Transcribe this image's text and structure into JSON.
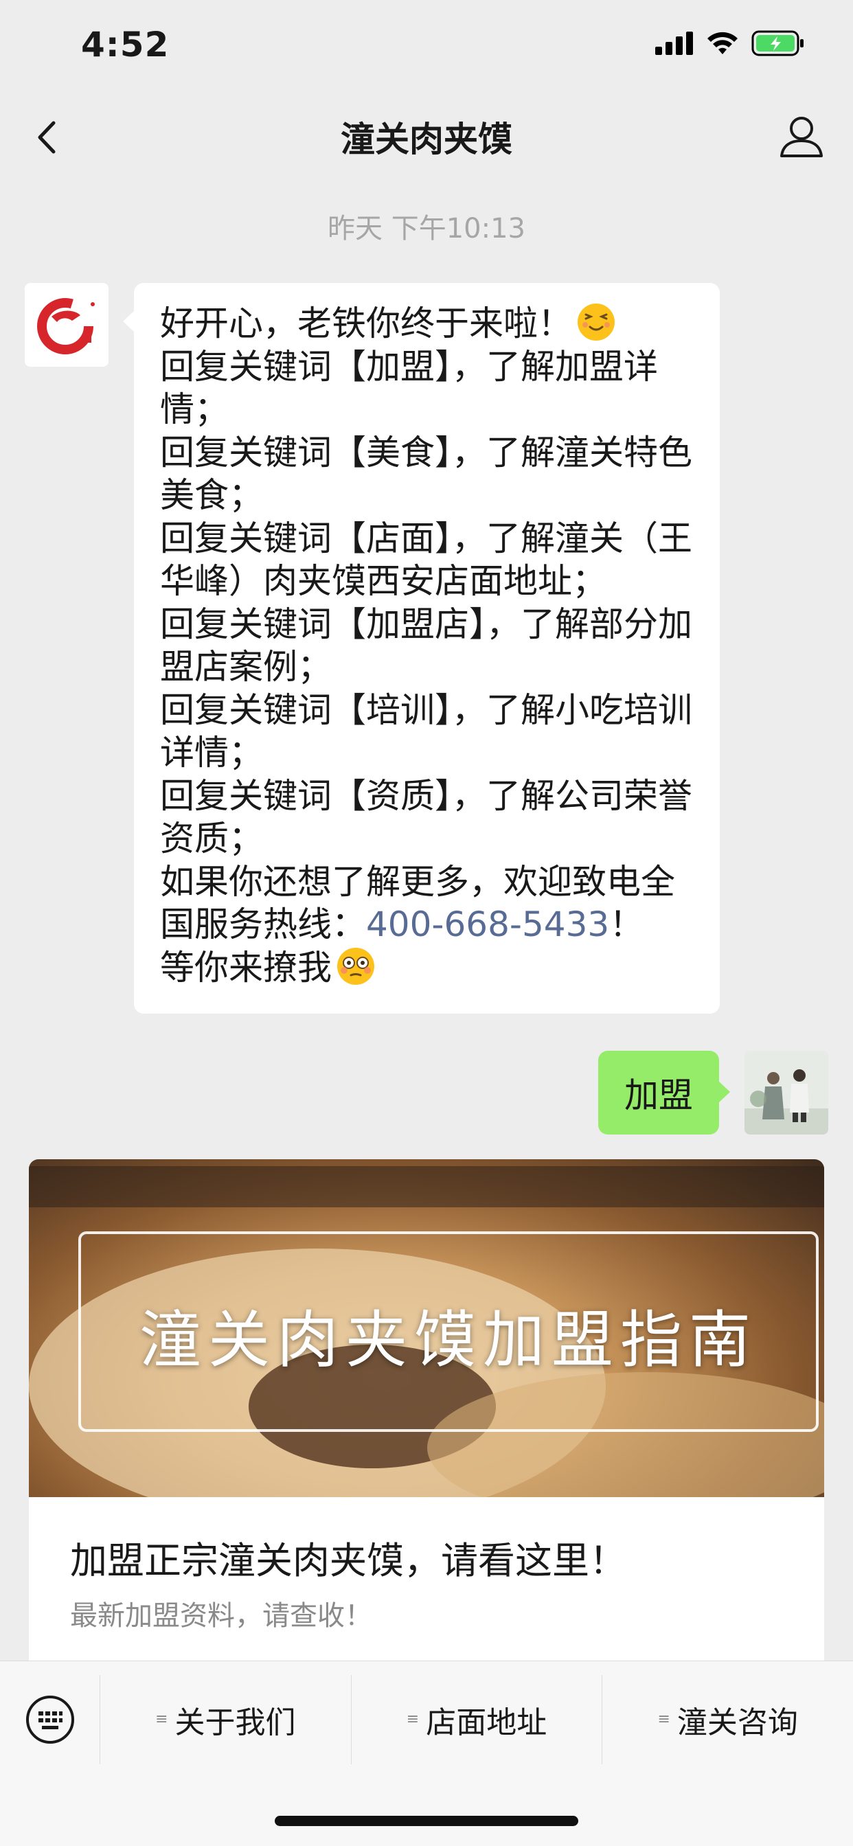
{
  "status_bar": {
    "time": "4:52"
  },
  "nav": {
    "title": "潼关肉夹馍"
  },
  "timestamp": "昨天 下午10:13",
  "incoming_message": {
    "lines": [
      "好开心，老铁你终于来啦！",
      "回复关键词【加盟】，了解加盟详情；",
      "回复关键词【美食】，了解潼关特色美食；",
      "回复关键词【店面】，了解潼关（王华峰）肉夹馍西安店面地址；",
      "回复关键词【加盟店】，了解部分加盟店案例；",
      "回复关键词【培训】，了解小吃培训详情；",
      "回复关键词【资质】，了解公司荣誉资质；"
    ],
    "hotline_prefix": "如果你还想了解更多，欢迎致电全国服务热线：",
    "hotline_number": "400-668-5433",
    "hotline_suffix": "！",
    "closing": "等你来撩我"
  },
  "outgoing_message": {
    "text": "加盟"
  },
  "article": {
    "cover_text": "潼关肉夹馍加盟指南",
    "title": "加盟正宗潼关肉夹馍，请看这里！",
    "description": "最新加盟资料，请查收！"
  },
  "menu": {
    "items": [
      {
        "label": "关于我们"
      },
      {
        "label": "店面地址"
      },
      {
        "label": "潼关咨询"
      }
    ]
  },
  "colors": {
    "background": "#ededed",
    "outgoing_bubble": "#95ec69",
    "link": "#576b95",
    "logo_red": "#d7262b"
  }
}
